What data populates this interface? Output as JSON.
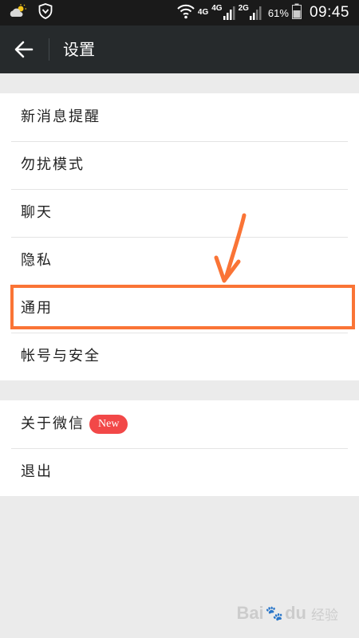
{
  "status_bar": {
    "network_1": "4G",
    "network_2": "4G",
    "network_3": "2G",
    "battery": "61%",
    "time": "09:45",
    "icons": [
      "weather-icon",
      "shield-icon",
      "wifi-icon",
      "signal-icon",
      "battery-icon"
    ]
  },
  "header": {
    "title": "设置",
    "back_icon": "arrow-left-icon"
  },
  "settings_group_1": [
    {
      "label": "新消息提醒"
    },
    {
      "label": "勿扰模式"
    },
    {
      "label": "聊天"
    },
    {
      "label": "隐私"
    },
    {
      "label": "通用"
    },
    {
      "label": "帐号与安全"
    }
  ],
  "settings_group_2": [
    {
      "label": "关于微信",
      "badge": "New"
    },
    {
      "label": "退出"
    }
  ],
  "annotation": {
    "highlight_color": "#fa7436",
    "highlighted_item": "通用"
  },
  "watermark": {
    "brand": "Bai",
    "paw": "🐾",
    "suffix": "du",
    "sub": "经验"
  }
}
